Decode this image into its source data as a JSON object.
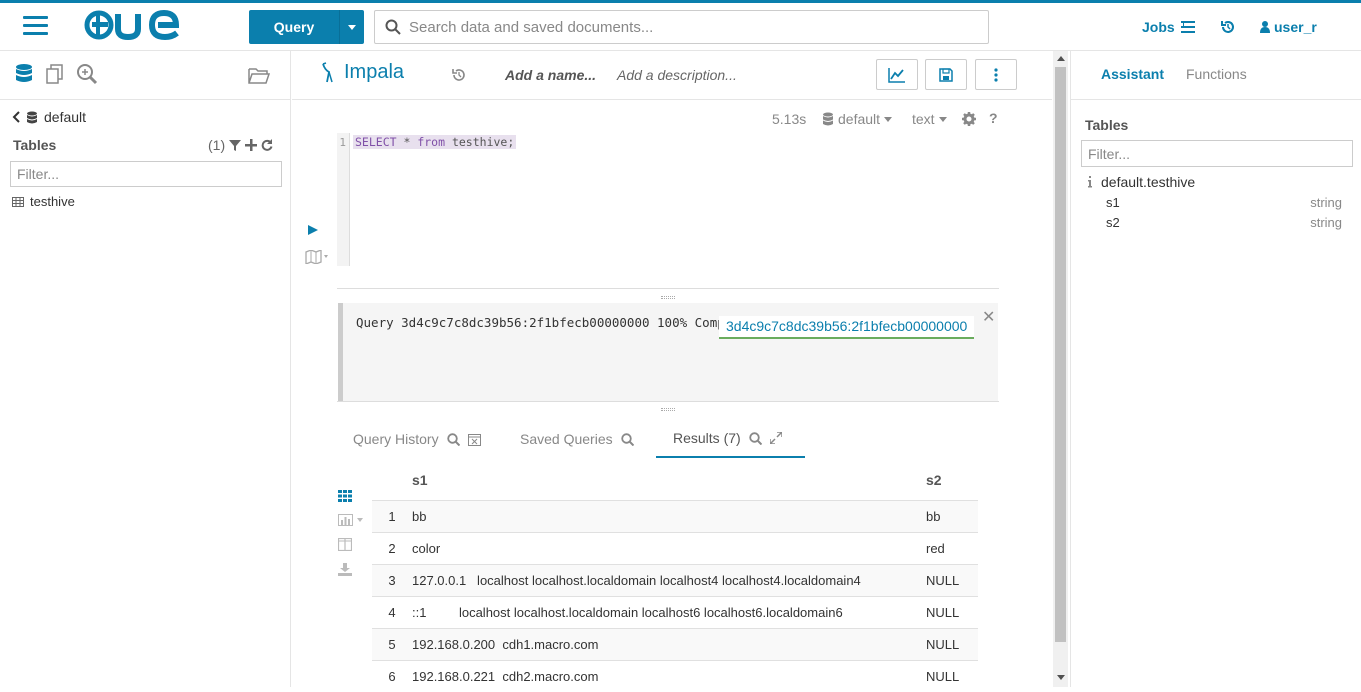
{
  "topbar": {
    "query_label": "Query",
    "search_placeholder": "Search data and saved documents...",
    "jobs_label": "Jobs",
    "user_label": "user_r"
  },
  "left": {
    "database": "default",
    "tables_header": "Tables",
    "table_count": "(1)",
    "filter_placeholder": "Filter...",
    "tables": [
      "testhive"
    ]
  },
  "editor": {
    "engine": "Impala",
    "name_placeholder": "Add a name...",
    "description_placeholder": "Add a description...",
    "duration": "5.13s",
    "database": "default",
    "format": "text",
    "line_number": "1",
    "sql_keyword_select": "SELECT",
    "sql_mid": " * ",
    "sql_keyword_from": "from",
    "sql_rest": " testhive;"
  },
  "log": {
    "text": "Query 3d4c9c7c8dc39b56:2f1bfecb00000000 100% Compl",
    "query_id_tag": "3d4c9c7c8dc39b56:2f1bfecb00000000"
  },
  "tabs": {
    "history": "Query History",
    "saved": "Saved Queries",
    "results": "Results (7)"
  },
  "results": {
    "columns": [
      "s1",
      "s2"
    ],
    "rows": [
      [
        "1",
        "bb",
        "bb"
      ],
      [
        "2",
        "color",
        "red"
      ],
      [
        "3",
        "127.0.0.1   localhost localhost.localdomain localhost4 localhost4.localdomain4",
        "NULL"
      ],
      [
        "4",
        "::1         localhost localhost.localdomain localhost6 localhost6.localdomain6",
        "NULL"
      ],
      [
        "5",
        "192.168.0.200  cdh1.macro.com",
        "NULL"
      ],
      [
        "6",
        "192.168.0.221  cdh2.macro.com",
        "NULL"
      ]
    ]
  },
  "right": {
    "tab_assistant": "Assistant",
    "tab_functions": "Functions",
    "tables_header": "Tables",
    "filter_placeholder": "Filter...",
    "table_name": "default.testhive",
    "columns": [
      {
        "name": "s1",
        "type": "string"
      },
      {
        "name": "s2",
        "type": "string"
      }
    ]
  },
  "colors": {
    "accent": "#0b7fad",
    "success": "#6aac5e"
  }
}
